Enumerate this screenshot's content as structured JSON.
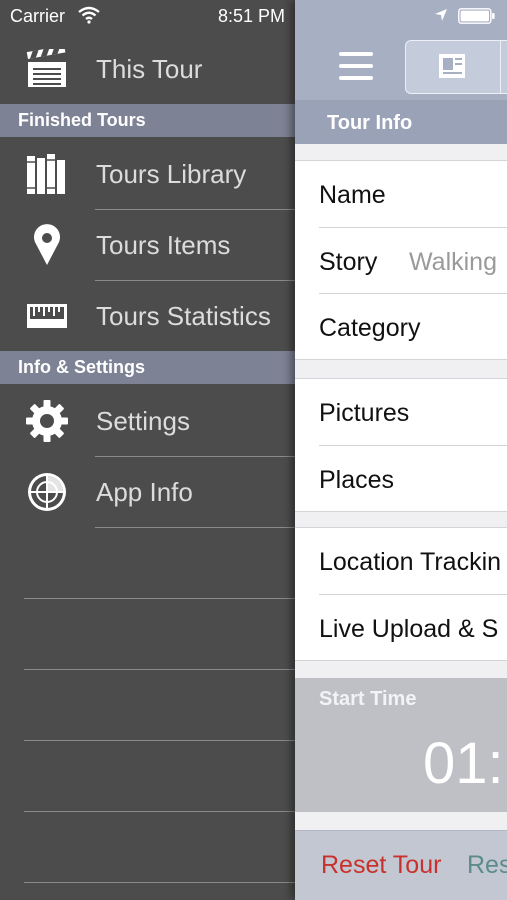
{
  "status_bar": {
    "carrier": "Carrier",
    "time": "8:51 PM"
  },
  "side_menu": {
    "top_item": {
      "label": "This Tour",
      "icon": "clapperboard-icon"
    },
    "sections": [
      {
        "title": "Finished Tours",
        "items": [
          {
            "label": "Tours Library",
            "icon": "books-icon"
          },
          {
            "label": "Tours Items",
            "icon": "map-pin-icon"
          },
          {
            "label": "Tours Statistics",
            "icon": "ruler-icon"
          }
        ]
      },
      {
        "title": "Info & Settings",
        "items": [
          {
            "label": "Settings",
            "icon": "gear-icon"
          },
          {
            "label": "App Info",
            "icon": "radar-icon"
          }
        ]
      }
    ]
  },
  "main": {
    "nav": {
      "menu_icon": "hamburger-icon",
      "segment_icon": "tour-info-icon"
    },
    "section_title": "Tour Info",
    "group1": [
      {
        "title": "Name",
        "detail": ""
      },
      {
        "title": "Story",
        "detail": "Walking"
      },
      {
        "title": "Category",
        "detail": ""
      }
    ],
    "group2": [
      {
        "title": "Pictures"
      },
      {
        "title": "Places"
      }
    ],
    "group3": [
      {
        "title": "Location Trackin"
      },
      {
        "title": "Live Upload & S"
      }
    ],
    "start_time": {
      "label": "Start Time",
      "value": "01:"
    },
    "toolbar": {
      "reset_label": "Reset Tour",
      "resume_label": "Res"
    }
  },
  "colors": {
    "menu_bg": "#4c4c4c",
    "section_header": "#7d8294",
    "nav_bar": "#a7afc3",
    "reset_red": "#c8312d"
  }
}
